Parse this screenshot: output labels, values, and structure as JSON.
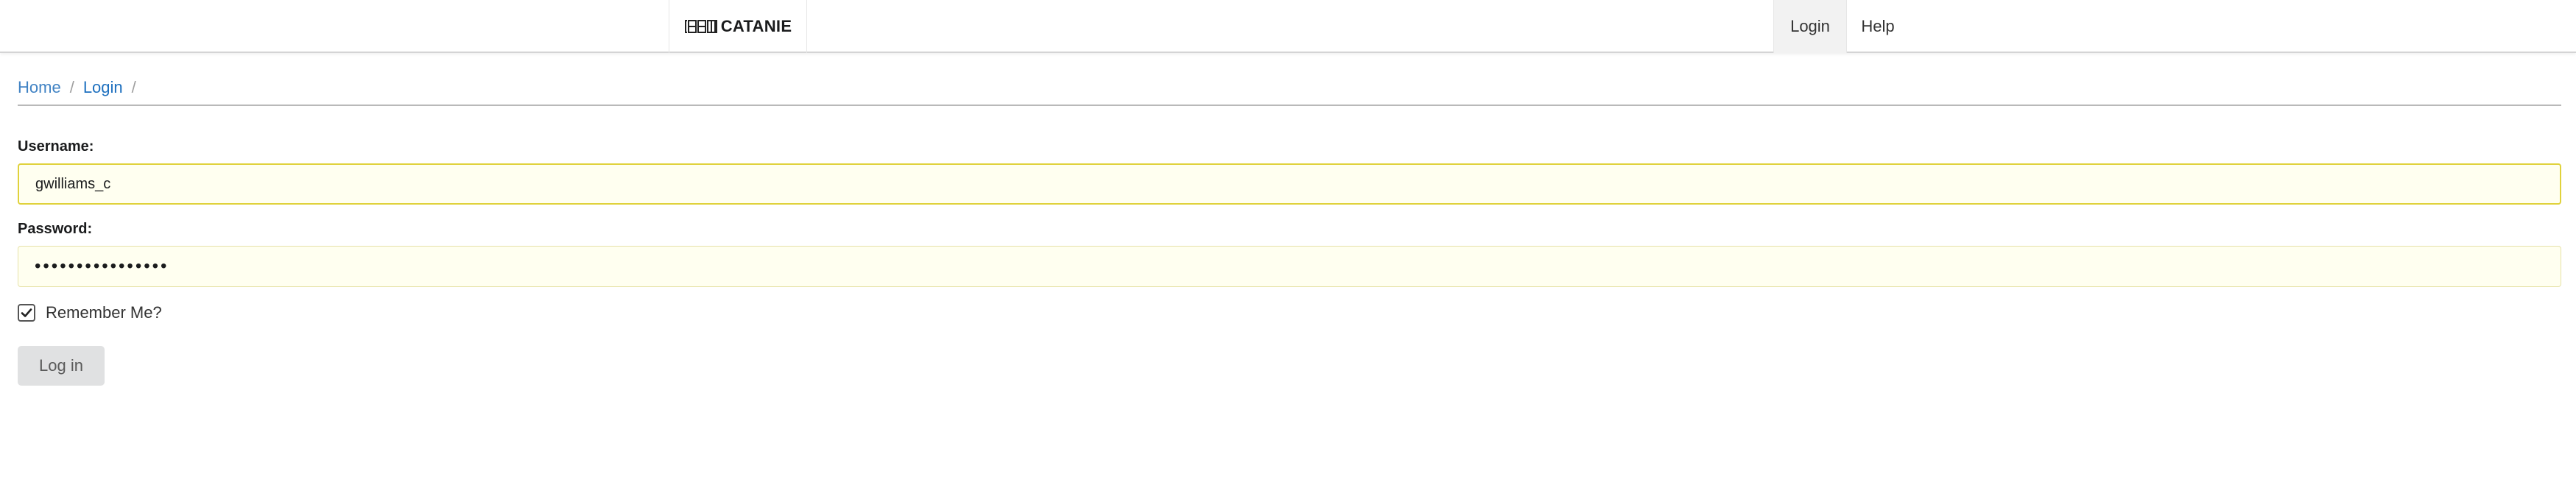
{
  "header": {
    "brand_name": "CATANIE",
    "logo_icon": "catanie-logo-icon",
    "nav": {
      "login_label": "Login",
      "help_label": "Help"
    }
  },
  "breadcrumb": {
    "items": [
      "Home",
      "Login"
    ],
    "separator": "/"
  },
  "form": {
    "username_label": "Username:",
    "username_value": "gwilliams_c",
    "password_label": "Password:",
    "password_value": "••••••••••••••••",
    "remember_label": "Remember Me?",
    "remember_checked": true,
    "submit_label": "Log in"
  },
  "colors": {
    "link": "#4183c4",
    "input_bg": "#fffff0",
    "input_border_focus": "#e0d23c",
    "button_bg": "#e0e1e2"
  }
}
